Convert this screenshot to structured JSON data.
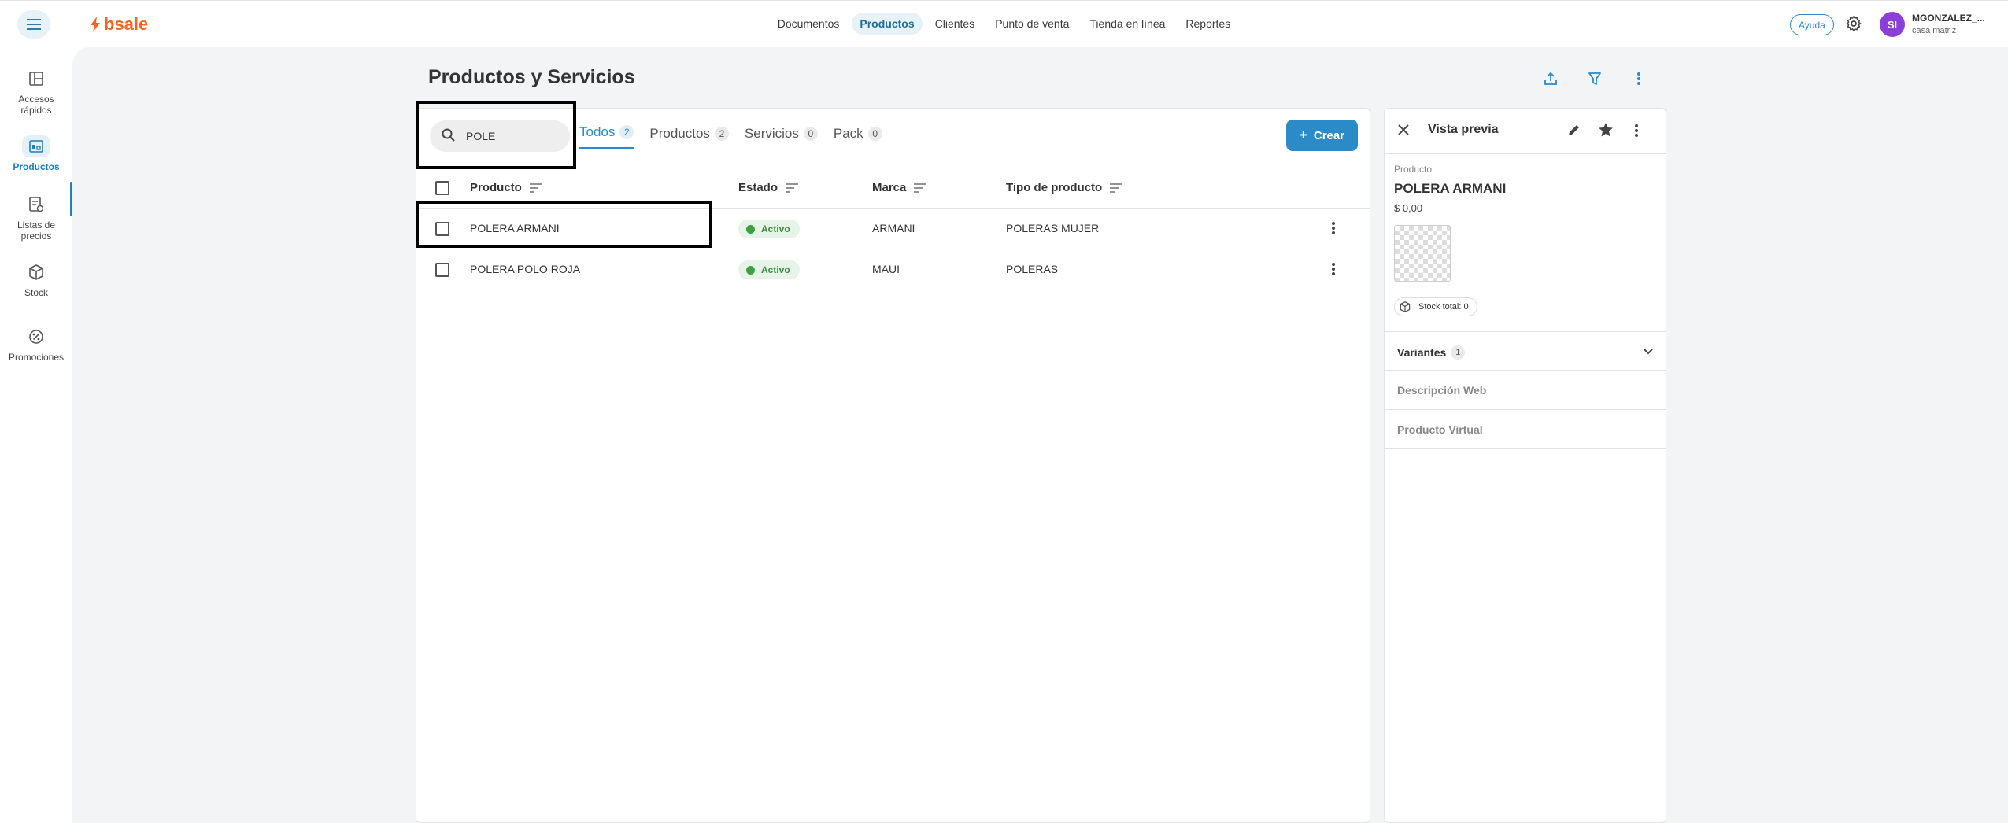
{
  "topbar": {
    "logo_text": "bsale",
    "nav": [
      "Documentos",
      "Productos",
      "Clientes",
      "Punto de venta",
      "Tienda en línea",
      "Reportes"
    ],
    "active_nav": "Productos",
    "help_label": "Ayuda",
    "avatar_initials": "SI",
    "user_name": "MGONZALEZ_...",
    "user_branch": "casa matriz"
  },
  "sidebar": {
    "items": [
      {
        "label": "Accesos rápidos",
        "icon": "dashboard-icon"
      },
      {
        "label": "Productos",
        "icon": "products-icon"
      },
      {
        "label": "Listas de precios",
        "icon": "price-list-icon"
      },
      {
        "label": "Stock",
        "icon": "box-icon"
      },
      {
        "label": "Promociones",
        "icon": "promo-icon"
      }
    ],
    "active": "Productos"
  },
  "page": {
    "title": "Productos y Servicios"
  },
  "search": {
    "value": "POLE"
  },
  "tabs": [
    {
      "label": "Todos",
      "count": "2",
      "active": true
    },
    {
      "label": "Productos",
      "count": "2",
      "active": false
    },
    {
      "label": "Servicios",
      "count": "0",
      "active": false
    },
    {
      "label": "Pack",
      "count": "0",
      "active": false
    }
  ],
  "create_label": "Crear",
  "table": {
    "headers": [
      "Producto",
      "Estado",
      "Marca",
      "Tipo de producto"
    ],
    "rows": [
      {
        "producto": "POLERA ARMANI",
        "estado": "Activo",
        "marca": "ARMANI",
        "tipo": "POLERAS MUJER"
      },
      {
        "producto": "POLERA POLO ROJA",
        "estado": "Activo",
        "marca": "MAUI",
        "tipo": "POLERAS"
      }
    ]
  },
  "preview": {
    "title": "Vista previa",
    "label": "Producto",
    "name": "POLERA ARMANI",
    "price": "$ 0,00",
    "stock": "Stock total: 0",
    "sections": [
      {
        "label": "Variantes",
        "count": "1"
      },
      {
        "label": "Descripción Web"
      },
      {
        "label": "Producto Virtual"
      }
    ]
  },
  "colors": {
    "accent": "#2a8bc8",
    "brand": "#f2661d",
    "status_active": "#3aa23f",
    "avatar": "#8b3fd8"
  }
}
